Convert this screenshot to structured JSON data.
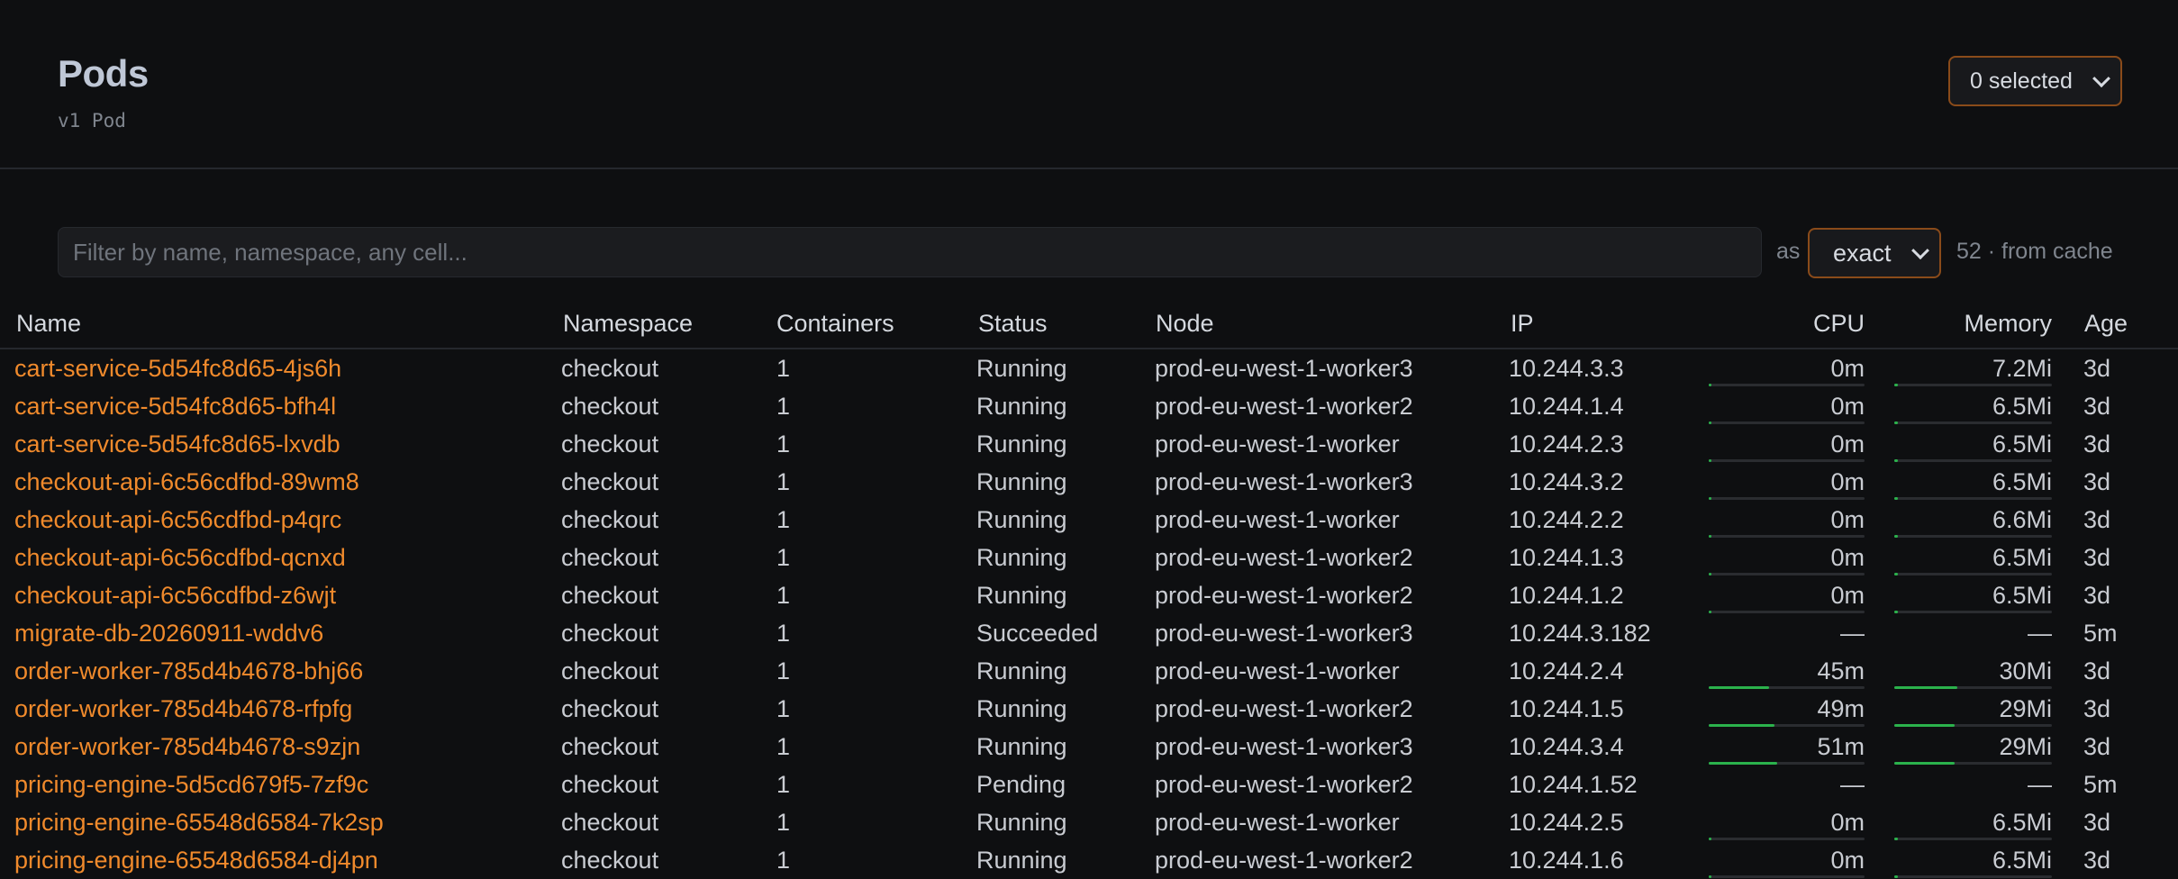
{
  "page": {
    "title": "Pods",
    "kind": "v1 Pod"
  },
  "selection": {
    "label": "0 selected"
  },
  "filter": {
    "placeholder": "Filter by name, namespace, any cell...",
    "value": "",
    "as_label": "as",
    "mode": "exact",
    "count": "52 · from cache"
  },
  "columns": {
    "name": "Name",
    "namespace": "Namespace",
    "containers": "Containers",
    "status": "Status",
    "node": "Node",
    "ip": "IP",
    "cpu": "CPU",
    "memory": "Memory",
    "age": "Age"
  },
  "colors": {
    "accent": "#f08a2c",
    "bar": "#2bb24c",
    "border": "#8a4b1a"
  },
  "rows": [
    {
      "name": "cart-service-5d54fc8d65-4js6h",
      "namespace": "checkout",
      "containers": "1",
      "status": "Running",
      "node": "prod-eu-west-1-worker3",
      "ip": "10.244.3.3",
      "cpu": "0m",
      "cpu_usage": 0,
      "memory": "7.2Mi",
      "memory_usage": 0.02,
      "age": "3d"
    },
    {
      "name": "cart-service-5d54fc8d65-bfh4l",
      "namespace": "checkout",
      "containers": "1",
      "status": "Running",
      "node": "prod-eu-west-1-worker2",
      "ip": "10.244.1.4",
      "cpu": "0m",
      "cpu_usage": 0,
      "memory": "6.5Mi",
      "memory_usage": 0.02,
      "age": "3d"
    },
    {
      "name": "cart-service-5d54fc8d65-lxvdb",
      "namespace": "checkout",
      "containers": "1",
      "status": "Running",
      "node": "prod-eu-west-1-worker",
      "ip": "10.244.2.3",
      "cpu": "0m",
      "cpu_usage": 0,
      "memory": "6.5Mi",
      "memory_usage": 0.02,
      "age": "3d"
    },
    {
      "name": "checkout-api-6c56cdfbd-89wm8",
      "namespace": "checkout",
      "containers": "1",
      "status": "Running",
      "node": "prod-eu-west-1-worker3",
      "ip": "10.244.3.2",
      "cpu": "0m",
      "cpu_usage": 0,
      "memory": "6.5Mi",
      "memory_usage": 0.02,
      "age": "3d"
    },
    {
      "name": "checkout-api-6c56cdfbd-p4qrc",
      "namespace": "checkout",
      "containers": "1",
      "status": "Running",
      "node": "prod-eu-west-1-worker",
      "ip": "10.244.2.2",
      "cpu": "0m",
      "cpu_usage": 0,
      "memory": "6.6Mi",
      "memory_usage": 0.02,
      "age": "3d"
    },
    {
      "name": "checkout-api-6c56cdfbd-qcnxd",
      "namespace": "checkout",
      "containers": "1",
      "status": "Running",
      "node": "prod-eu-west-1-worker2",
      "ip": "10.244.1.3",
      "cpu": "0m",
      "cpu_usage": 0,
      "memory": "6.5Mi",
      "memory_usage": 0.02,
      "age": "3d"
    },
    {
      "name": "checkout-api-6c56cdfbd-z6wjt",
      "namespace": "checkout",
      "containers": "1",
      "status": "Running",
      "node": "prod-eu-west-1-worker2",
      "ip": "10.244.1.2",
      "cpu": "0m",
      "cpu_usage": 0,
      "memory": "6.5Mi",
      "memory_usage": 0.02,
      "age": "3d"
    },
    {
      "name": "migrate-db-20260911-wddv6",
      "namespace": "checkout",
      "containers": "1",
      "status": "Succeeded",
      "node": "prod-eu-west-1-worker3",
      "ip": "10.244.3.182",
      "cpu": "—",
      "cpu_usage": null,
      "memory": "—",
      "memory_usage": null,
      "age": "5m"
    },
    {
      "name": "order-worker-785d4b4678-bhj66",
      "namespace": "checkout",
      "containers": "1",
      "status": "Running",
      "node": "prod-eu-west-1-worker",
      "ip": "10.244.2.4",
      "cpu": "45m",
      "cpu_usage": 0.39,
      "memory": "30Mi",
      "memory_usage": 0.4,
      "age": "3d"
    },
    {
      "name": "order-worker-785d4b4678-rfpfg",
      "namespace": "checkout",
      "containers": "1",
      "status": "Running",
      "node": "prod-eu-west-1-worker2",
      "ip": "10.244.1.5",
      "cpu": "49m",
      "cpu_usage": 0.42,
      "memory": "29Mi",
      "memory_usage": 0.38,
      "age": "3d"
    },
    {
      "name": "order-worker-785d4b4678-s9zjn",
      "namespace": "checkout",
      "containers": "1",
      "status": "Running",
      "node": "prod-eu-west-1-worker3",
      "ip": "10.244.3.4",
      "cpu": "51m",
      "cpu_usage": 0.44,
      "memory": "29Mi",
      "memory_usage": 0.38,
      "age": "3d"
    },
    {
      "name": "pricing-engine-5d5cd679f5-7zf9c",
      "namespace": "checkout",
      "containers": "1",
      "status": "Pending",
      "node": "prod-eu-west-1-worker2",
      "ip": "10.244.1.52",
      "cpu": "—",
      "cpu_usage": null,
      "memory": "—",
      "memory_usage": null,
      "age": "5m"
    },
    {
      "name": "pricing-engine-65548d6584-7k2sp",
      "namespace": "checkout",
      "containers": "1",
      "status": "Running",
      "node": "prod-eu-west-1-worker",
      "ip": "10.244.2.5",
      "cpu": "0m",
      "cpu_usage": 0,
      "memory": "6.5Mi",
      "memory_usage": 0.02,
      "age": "3d"
    },
    {
      "name": "pricing-engine-65548d6584-dj4pn",
      "namespace": "checkout",
      "containers": "1",
      "status": "Running",
      "node": "prod-eu-west-1-worker2",
      "ip": "10.244.1.6",
      "cpu": "0m",
      "cpu_usage": 0,
      "memory": "6.5Mi",
      "memory_usage": 0.02,
      "age": "3d"
    }
  ]
}
